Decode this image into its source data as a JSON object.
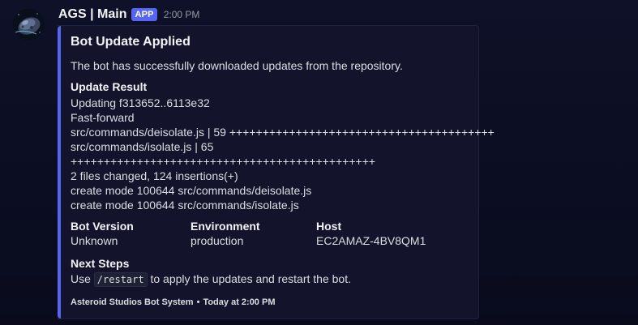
{
  "message": {
    "username": "AGS | Main",
    "badge": "APP",
    "timestamp": "2:00 PM",
    "avatar_icon": "asteroid-avatar-icon"
  },
  "embed": {
    "accent_color": "#5865f2",
    "title": "Bot Update Applied",
    "description": "The bot has successfully downloaded updates from the repository.",
    "update_result": {
      "name": "Update Result",
      "lines": [
        "Updating f313652..6113e32",
        "Fast-forward",
        "src/commands/deisolate.js | 59 ++++++++++++++++++++++++++++++++++++++++",
        "src/commands/isolate.js | 65",
        "++++++++++++++++++++++++++++++++++++++++++++++",
        "2 files changed, 124 insertions(+)",
        "create mode 100644 src/commands/deisolate.js",
        "create mode 100644 src/commands/isolate.js"
      ]
    },
    "fields": [
      {
        "name": "Bot Version",
        "value": "Unknown"
      },
      {
        "name": "Environment",
        "value": "production"
      },
      {
        "name": "Host",
        "value": "EC2AMAZ-4BV8QM1"
      }
    ],
    "next_steps": {
      "name": "Next Steps",
      "prefix": "Use",
      "code": "/restart",
      "suffix": "to apply the updates and restart the bot."
    },
    "footer": {
      "text": "Asteroid Studios Bot System",
      "separator": "•",
      "timestamp": "Today at 2:00 PM"
    }
  }
}
